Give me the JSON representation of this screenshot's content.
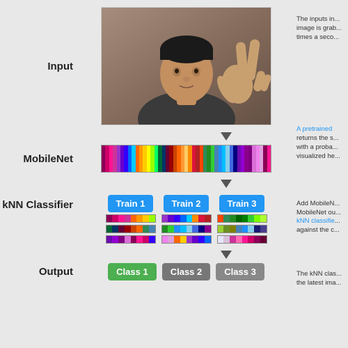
{
  "labels": {
    "input": "Input",
    "mobilenet": "MobileNet",
    "knn": "kNN Classifier",
    "output": "Output"
  },
  "train_buttons": [
    {
      "label": "Train 1",
      "class": "train-btn-1"
    },
    {
      "label": "Train 2",
      "class": "train-btn-2"
    },
    {
      "label": "Train 3",
      "class": "train-btn-3"
    }
  ],
  "class_buttons": [
    {
      "label": "Class 1",
      "class": "class-btn-1"
    },
    {
      "label": "Class 2",
      "class": "class-btn-2"
    },
    {
      "label": "Class 3",
      "class": "class-btn-3"
    }
  ],
  "right_panel": {
    "input_desc": "The inputs in... image is grab... times a seco...",
    "mobilenet_desc": "returns the s... with a proba... visualized he...",
    "mobilenet_link": "A pretrained",
    "knn_desc": "Add MobileN... MobileNet ou... against the c...",
    "knn_link": "kNN classifie",
    "output_desc": "The kNN clas... the latest ima..."
  },
  "colors": {
    "bar_colors": [
      "#8B0057",
      "#CC0066",
      "#FF1493",
      "#FF69B4",
      "#CC3399",
      "#9932CC",
      "#6600CC",
      "#3300FF",
      "#0066FF",
      "#00CCFF",
      "#FF6600",
      "#FF9900",
      "#FFCC00",
      "#FFFF00",
      "#99FF00",
      "#00FF66",
      "#006633",
      "#003366",
      "#660033",
      "#990000",
      "#CC4400",
      "#FF6600",
      "#FF9933",
      "#FFCC66",
      "#FF8C00",
      "#DC143C",
      "#B22222",
      "#8B0000",
      "#FF4500",
      "#FF6347",
      "#2E8B57",
      "#228B22",
      "#006400",
      "#008000",
      "#32CD32",
      "#7CFC00",
      "#ADFF2F",
      "#9ACD32",
      "#6B8E23",
      "#808000",
      "#4682B4",
      "#1E90FF",
      "#00BFFF",
      "#87CEEB",
      "#87CEFA",
      "#4169E1",
      "#0000CD",
      "#000080",
      "#191970",
      "#483D8B",
      "#6A0DAD",
      "#9400D3",
      "#8B008B",
      "#800080",
      "#DA70D6",
      "#EE82EE",
      "#DDA0DD",
      "#D8BFD8",
      "#E6E6FA"
    ]
  }
}
